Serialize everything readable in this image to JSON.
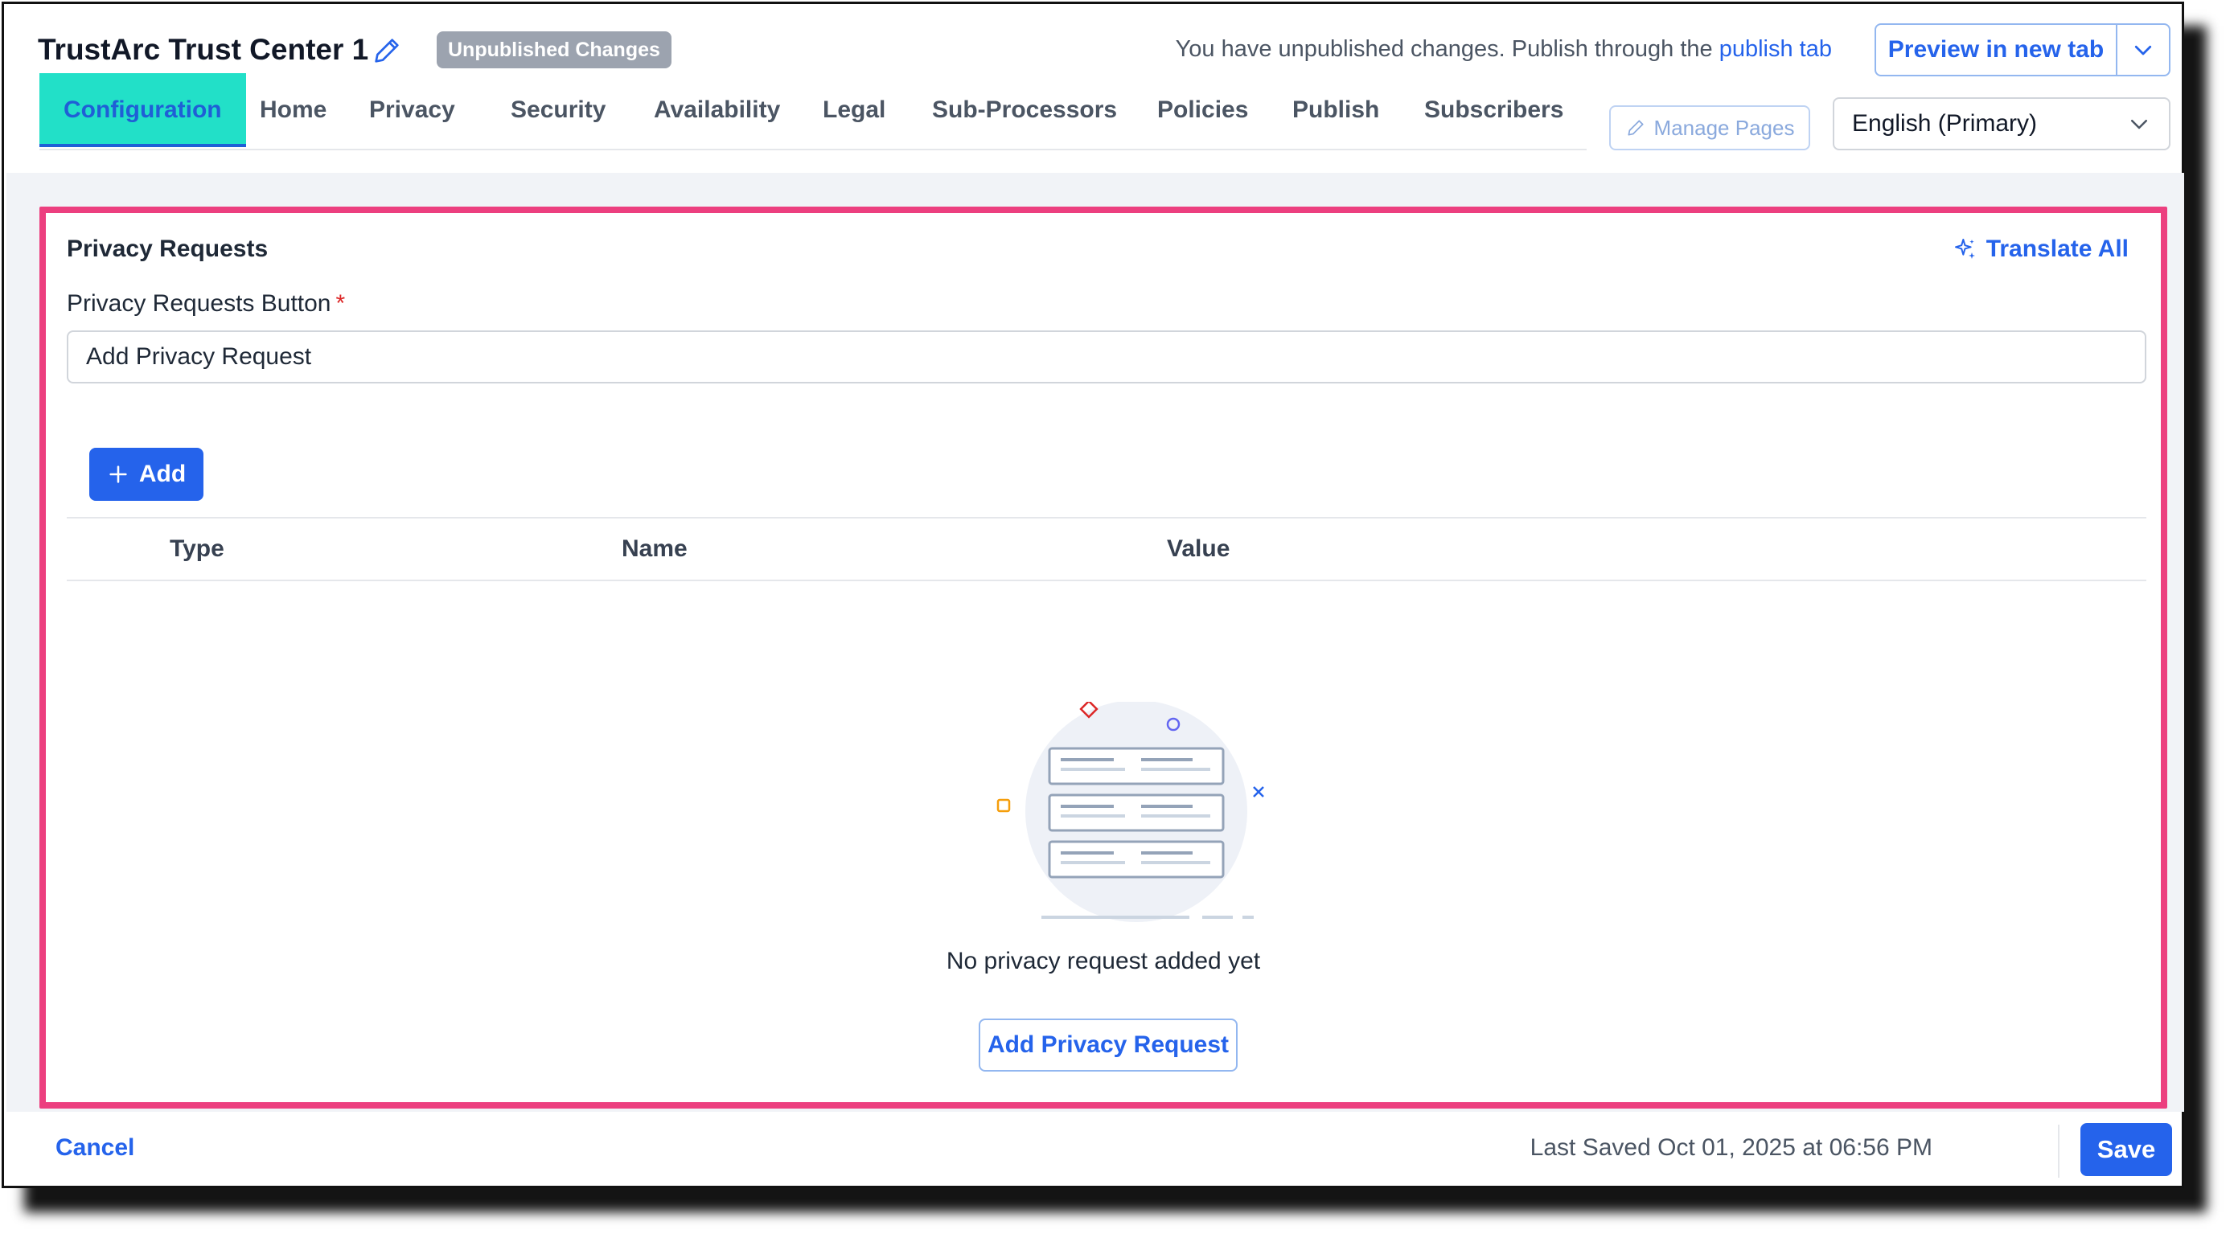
{
  "header": {
    "title": "TrustArc Trust Center 1",
    "badge": "Unpublished Changes",
    "notice_prefix": "You have unpublished changes. Publish through the",
    "notice_link": "publish tab",
    "preview_label": "Preview in new tab"
  },
  "tabs": [
    {
      "label": "Configuration",
      "active": true
    },
    {
      "label": "Home"
    },
    {
      "label": "Privacy"
    },
    {
      "label": "Security"
    },
    {
      "label": "Availability"
    },
    {
      "label": "Legal"
    },
    {
      "label": "Sub-Processors"
    },
    {
      "label": "Policies"
    },
    {
      "label": "Publish"
    },
    {
      "label": "Subscribers"
    }
  ],
  "manage_pages_label": "Manage Pages",
  "language": {
    "selected": "English (Primary)"
  },
  "card": {
    "title": "Privacy Requests",
    "translate_label": "Translate All",
    "field_label": "Privacy Requests Button",
    "required_mark": "*",
    "field_value": "Add Privacy Request",
    "add_label": "Add",
    "columns": [
      "Type",
      "Name",
      "Value"
    ],
    "empty_text": "No privacy request added yet",
    "empty_button": "Add Privacy Request"
  },
  "footer": {
    "cancel_label": "Cancel",
    "last_saved": "Last Saved Oct 01, 2025 at 06:56 PM",
    "save_label": "Save"
  },
  "colors": {
    "accent": "#2563eb",
    "active_tab_bg": "#22e0c8",
    "highlight_border": "#ec3f7f",
    "badge_bg": "#9ca3af"
  }
}
